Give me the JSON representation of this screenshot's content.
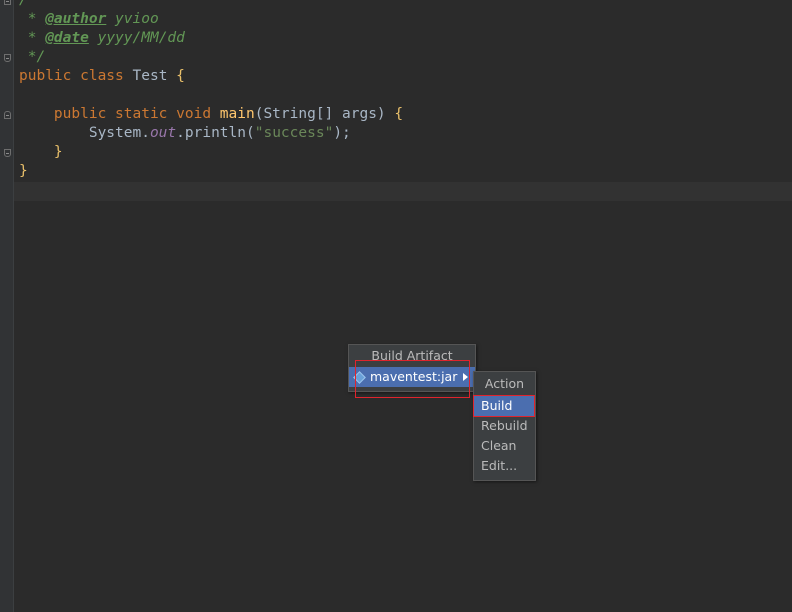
{
  "code": {
    "line1": "/**",
    "line2_prefix": " * ",
    "line2_tag": "@author",
    "line2_value": " yvioo",
    "line3_prefix": " * ",
    "line3_tag": "@date",
    "line3_value": " yyyy/MM/dd",
    "line4": " */",
    "line5_kw": "public class ",
    "line5_name": "Test ",
    "line5_brace": "{",
    "line7_indent": "    ",
    "line7_kw": "public static void ",
    "line7_fn": "main",
    "line7_rest": "(String[] args) ",
    "line7_brace": "{",
    "line8_indent": "        ",
    "line8_obj": "System.",
    "line8_field": "out",
    "line8_call": ".println(",
    "line8_str": "\"success\"",
    "line8_end": ");",
    "line9_indent": "    ",
    "line9_brace": "}",
    "line10_brace": "}"
  },
  "build_menu": {
    "title": "Build Artifact",
    "artifact": "maventest:jar"
  },
  "action_menu": {
    "title": "Action",
    "items": [
      "Build",
      "Rebuild",
      "Clean",
      "Edit..."
    ]
  },
  "colors": {
    "background": "#2b2b2b",
    "selection": "#4b6eaf",
    "highlight_box": "#e0242d"
  }
}
